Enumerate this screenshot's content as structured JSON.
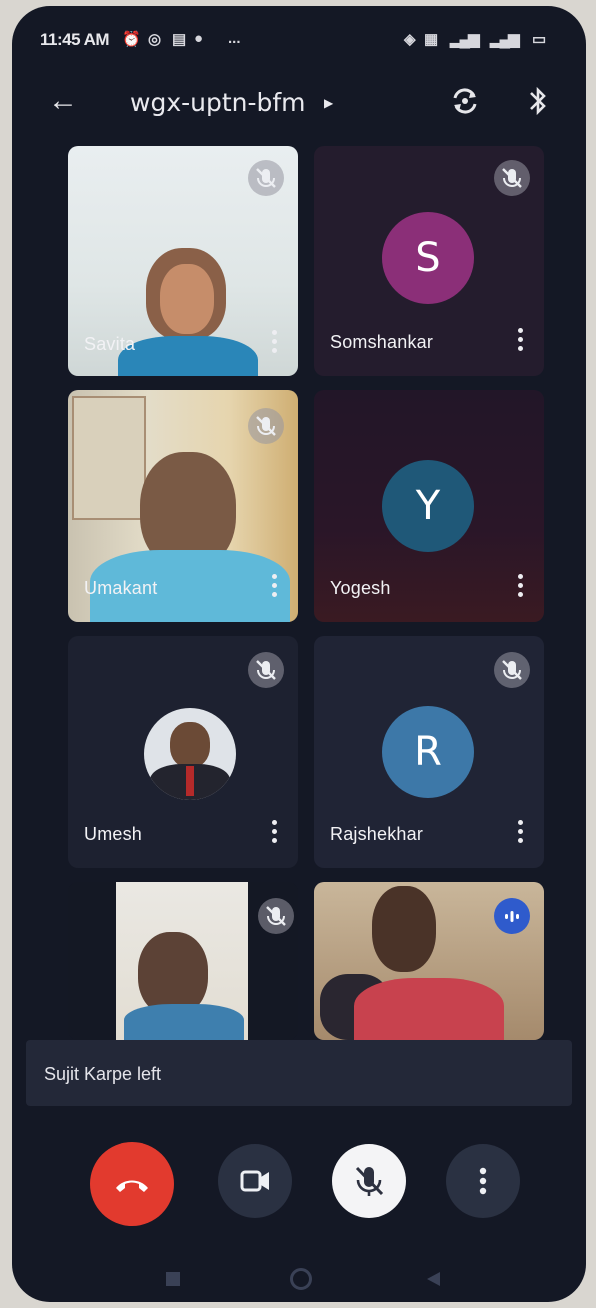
{
  "status_bar": {
    "time": "11:45 AM",
    "more_indicator": "..."
  },
  "header": {
    "meeting_code": "wgx-uptn-bfm",
    "back_icon": "arrow-left",
    "switch_camera_icon": "camera-switch",
    "audio_icon": "bluetooth"
  },
  "participants": [
    {
      "name": "Savita",
      "type": "video",
      "muted": true
    },
    {
      "name": "Somshankar",
      "type": "avatar",
      "initial": "S",
      "color": "#8b2f78",
      "muted": true
    },
    {
      "name": "Umakant",
      "type": "video",
      "muted": true
    },
    {
      "name": "Yogesh",
      "type": "avatar",
      "initial": "Y",
      "color": "#1f5878",
      "muted": false
    },
    {
      "name": "Umesh",
      "type": "avatar-photo",
      "muted": true
    },
    {
      "name": "Rajshekhar",
      "type": "avatar",
      "initial": "R",
      "color": "#3d78a8",
      "muted": true
    },
    {
      "name": "",
      "type": "video",
      "muted": true
    },
    {
      "name": "",
      "type": "video",
      "muted": false,
      "speaking": true
    }
  ],
  "toast": {
    "message": "Sujit Karpe left"
  },
  "controls": {
    "end_call_color": "#e23a2e",
    "end_call_icon": "phone-hangup",
    "camera_icon": "video-camera",
    "mic_icon": "mic-off",
    "more_icon": "more-vertical"
  },
  "nav": {
    "recents_icon": "square",
    "home_icon": "circle",
    "back_icon": "triangle"
  }
}
